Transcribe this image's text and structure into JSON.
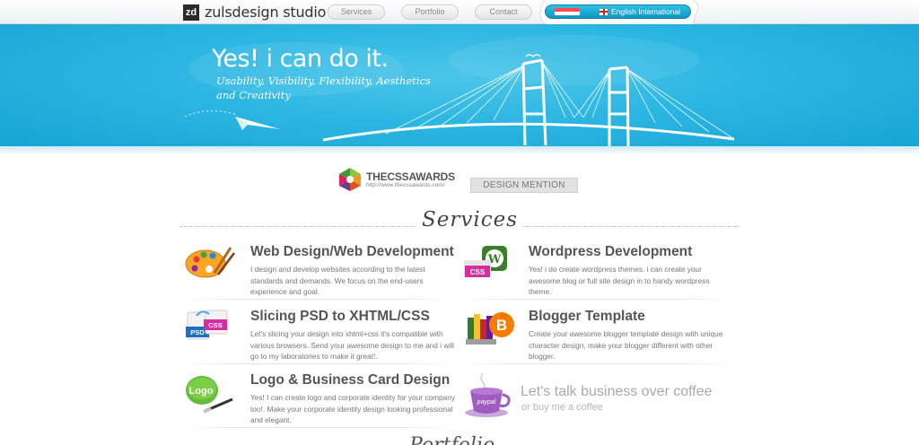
{
  "header": {
    "logo_mark": "zd",
    "logo_text": "zulsdesign studio",
    "nav": [
      {
        "label": "Services"
      },
      {
        "label": "Portfolio"
      },
      {
        "label": "Contact"
      }
    ],
    "language": "English International"
  },
  "hero": {
    "headline": "Yes!  i can do it.",
    "tagline": "Usability, Visibility, Flexibility, Aesthetics and Creativity"
  },
  "award": {
    "name": "THECSSAWARDS",
    "url": "http://www.thecssawards.com/",
    "badge": "DESIGN MENTION"
  },
  "services": {
    "title": "Services",
    "items": [
      {
        "title": "Web Design/Web Development",
        "text": "I design and develop websites according to the latest standards and demands. We focus on the end-users experience and goal.",
        "icon": "palette-icon"
      },
      {
        "title": "Wordpress Development",
        "text": "Yes! i do create wordpress themes. i can create your awesome blog or full site design in to handy wordpress theme.",
        "icon": "wordpress-css-icon"
      },
      {
        "title": "Slicing PSD to XHTML/CSS",
        "text": "Let's slicing your design into xhtml+css it's compatible with various browsers. Send your awesome design to me and i will go to my laboratories to make it great!.",
        "icon": "psd-to-css-icon"
      },
      {
        "title": "Blogger Template",
        "text": "Create your awesome blogger template design with unique character design, make your blogger different with other blogger.",
        "icon": "blogger-crayons-icon"
      },
      {
        "title": "Logo & Business Card Design",
        "text": "Yes! I can create logo and corporate identity for your company too!. Make your corporate identity design looking professional and elegant.",
        "icon": "logo-brush-icon"
      }
    ],
    "coffee": {
      "title": "Let's talk business over coffee",
      "subtitle": "or buy me a coffee",
      "cup_label": "paypal"
    }
  },
  "portfolio_peek": "Portfolio"
}
